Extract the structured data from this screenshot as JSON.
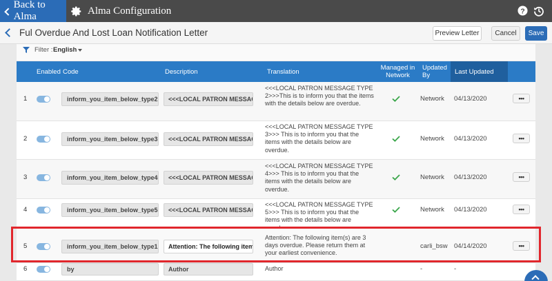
{
  "topbar": {
    "back_label": "Back to Alma",
    "app_title": "Alma Configuration",
    "icons": [
      "gear-icon",
      "help-icon",
      "history-icon"
    ]
  },
  "page": {
    "title": "Ful Overdue And Lost Loan Notification Letter",
    "preview_label": "Preview Letter",
    "cancel_label": "Cancel",
    "save_label": "Save"
  },
  "filter": {
    "label": "Filter :",
    "value": "English"
  },
  "table": {
    "headers": {
      "enabled": "Enabled",
      "code": "Code",
      "description": "Description",
      "translation": "Translation",
      "managed": "Managed in Network",
      "updated_by": "Updated By",
      "last_updated": "Last Updated"
    },
    "rows": [
      {
        "num": "1",
        "code": "inform_you_item_below_type2",
        "description": "<<<LOCAL PATRON MESSAGE T",
        "translation": "<<<LOCAL PATRON MESSAGE TYPE 2>>>This is to inform you that the items with the details below are overdue.",
        "managed": true,
        "updated_by": "Network",
        "last_updated": "04/13/2020",
        "more": "•••"
      },
      {
        "num": "2",
        "code": "inform_you_item_below_type3",
        "description": "<<<LOCAL PATRON MESSAGE T",
        "translation": "<<<LOCAL PATRON MESSAGE TYPE 3>>> This is to inform you that the items with the details below are overdue.",
        "managed": true,
        "updated_by": "Network",
        "last_updated": "04/13/2020",
        "more": "•••"
      },
      {
        "num": "3",
        "code": "inform_you_item_below_type4",
        "description": "<<<LOCAL PATRON MESSAGE T",
        "translation": "<<<LOCAL PATRON MESSAGE TYPE 4>>> This is to inform you that the items with the details below are overdue.",
        "managed": true,
        "updated_by": "Network",
        "last_updated": "04/13/2020",
        "more": "•••"
      },
      {
        "num": "4",
        "code": "inform_you_item_below_type5",
        "description": "<<<LOCAL PATRON MESSAGE T",
        "translation": "<<<LOCAL PATRON MESSAGE TYPE 5>>> This is to inform you that the items with the details below are overdue.",
        "managed": true,
        "updated_by": "Network",
        "last_updated": "04/13/2020",
        "more": "•••"
      },
      {
        "num": "5",
        "code": "inform_you_item_below_type1",
        "description": "Attention: The following item(s)",
        "translation": "Attention: The following item(s) are 3 days overdue. Please return them at your earliest convenience.",
        "managed": false,
        "updated_by": "carli_bsw",
        "last_updated": "04/14/2020",
        "more": "•••"
      },
      {
        "num": "6",
        "code": "by",
        "description": "Author",
        "translation": "Author",
        "managed": false,
        "updated_by": "-",
        "last_updated": "-",
        "more": ""
      }
    ]
  },
  "colors": {
    "accent": "#2b6cb7",
    "header": "#2b7bc6",
    "highlight": "#e1262c",
    "check": "#3aa64a"
  }
}
